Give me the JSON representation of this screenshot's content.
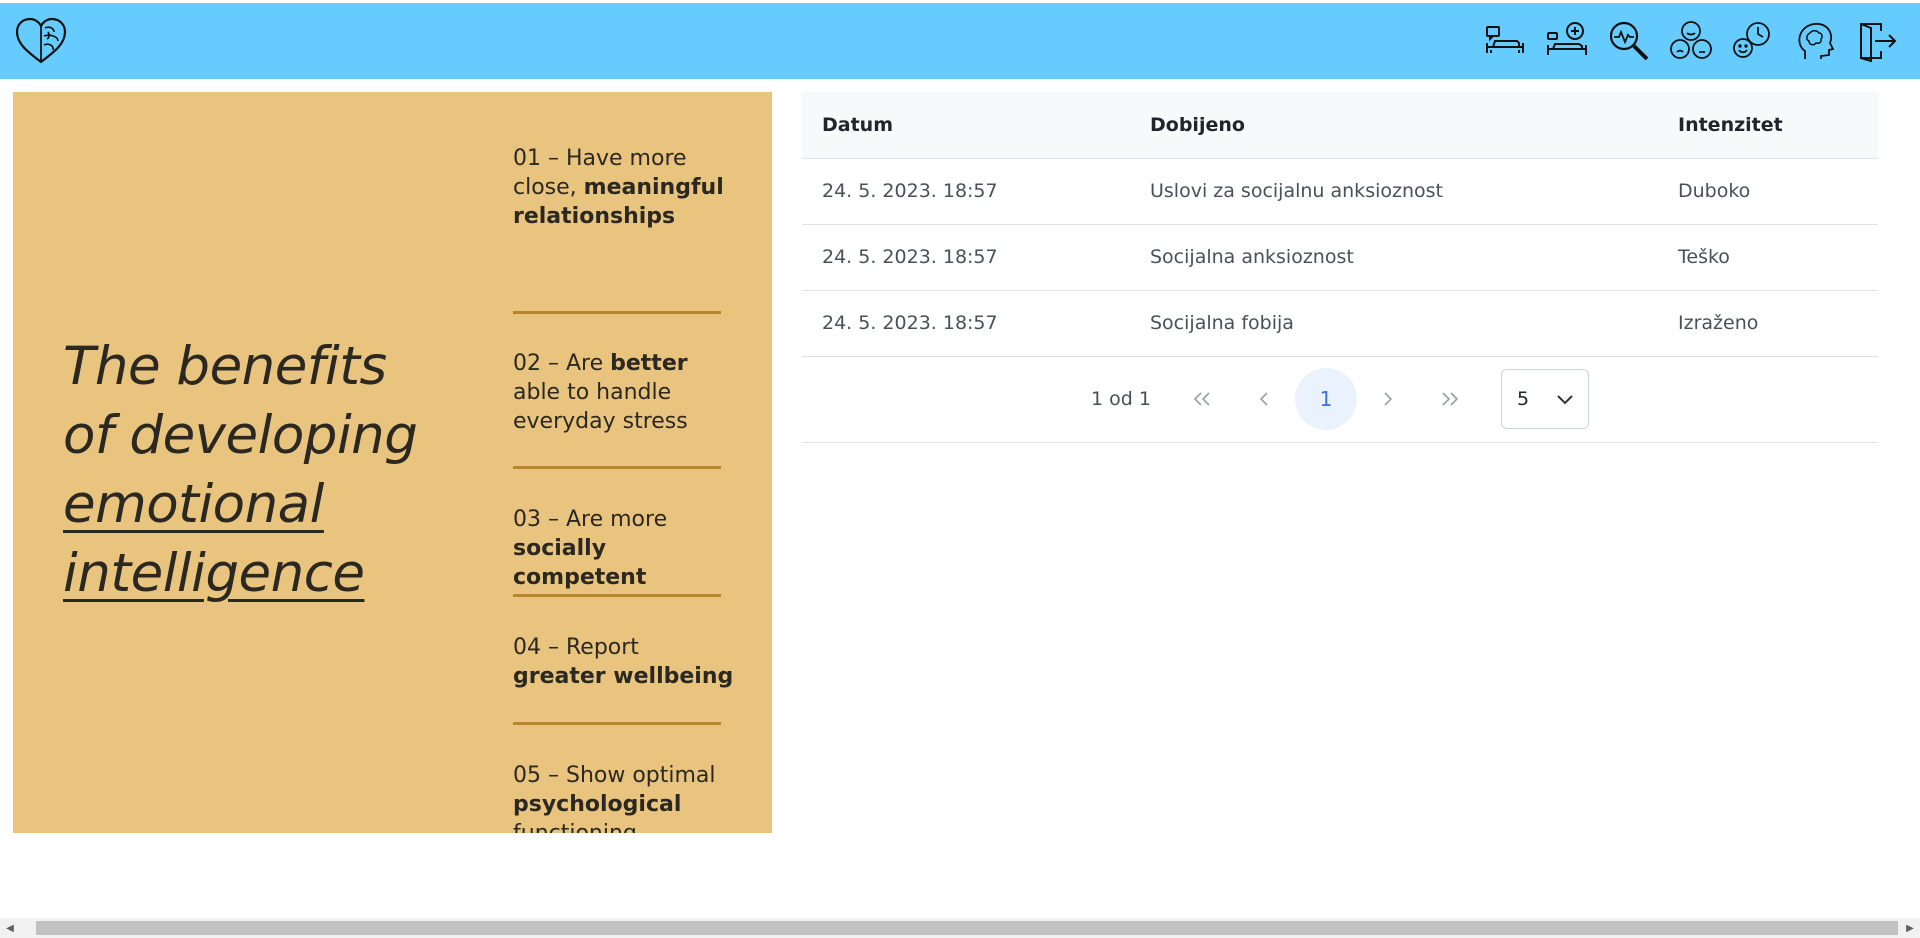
{
  "header": {
    "logo": "brain-heart-logo",
    "nav": [
      {
        "icon": "therapy-couch-chat-icon"
      },
      {
        "icon": "add-therapy-couch-icon"
      },
      {
        "icon": "search-analysis-icon"
      },
      {
        "icon": "moods-icon"
      },
      {
        "icon": "mood-history-icon"
      },
      {
        "icon": "mind-head-icon"
      },
      {
        "icon": "logout-icon"
      }
    ],
    "bg_color": "#66ccff"
  },
  "poster": {
    "bg_color": "#e9c47e",
    "title_lines": [
      "The benefits",
      "of developing",
      "emotional",
      "intelligence"
    ],
    "benefits": [
      {
        "normal": "01 – Have more close, ",
        "bold": "meaningful relationships",
        "tail": ""
      },
      {
        "normal": "02 – Are ",
        "bold": "better",
        "tail": " able to handle everyday stress"
      },
      {
        "normal": "03 – Are more ",
        "bold": "socially competent",
        "tail": ""
      },
      {
        "normal": "04 – Report ",
        "bold": "greater wellbeing",
        "tail": ""
      },
      {
        "normal": "05 – Show optimal ",
        "bold": "psychological",
        "tail": " functioning"
      }
    ]
  },
  "table": {
    "columns": [
      "Datum",
      "Dobijeno",
      "Intenzitet"
    ],
    "rows": [
      [
        "24. 5. 2023. 18:57",
        "Uslovi za socijalnu anksioznost",
        "Duboko"
      ],
      [
        "24. 5. 2023. 18:57",
        "Socijalna anksioznost",
        "Teško"
      ],
      [
        "24. 5. 2023. 18:57",
        "Socijalna fobija",
        "Izraženo"
      ]
    ]
  },
  "pager": {
    "info": "1 od 1",
    "first": "«",
    "prev": "‹",
    "current": "1",
    "next": "›",
    "last": "»",
    "page_size": "5",
    "active_color": "#3b6fd4"
  }
}
